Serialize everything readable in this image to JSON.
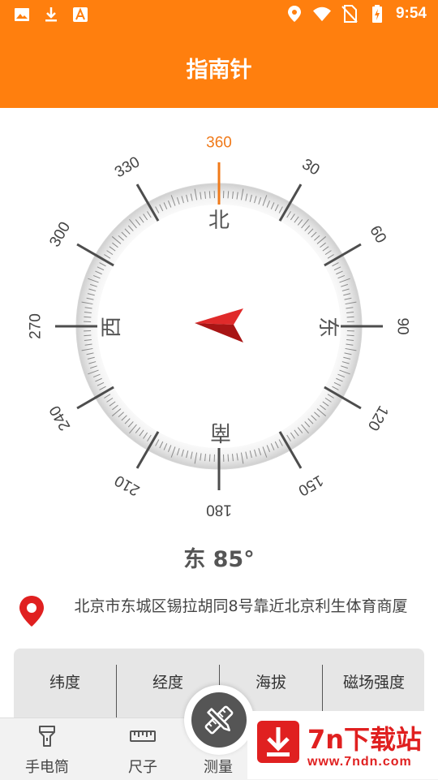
{
  "status_bar": {
    "left_icons": [
      "image-icon",
      "download-icon",
      "font-icon"
    ],
    "right_icons": [
      "location-icon",
      "wifi-icon",
      "no-sim-icon",
      "battery-charging-icon"
    ],
    "time": "9:54"
  },
  "header": {
    "title": "指南针"
  },
  "compass": {
    "degree_labels": [
      "360",
      "30",
      "60",
      "90",
      "120",
      "150",
      "180",
      "210",
      "240",
      "270",
      "300",
      "330"
    ],
    "cardinals": {
      "north": "北",
      "east": "东",
      "south": "南",
      "west": "西"
    },
    "heading_degrees": 85,
    "accent_color": "#f07a1a",
    "needle_color": "#c41f1f"
  },
  "heading": {
    "text": "东 85°"
  },
  "location": {
    "address": "北京市东城区锡拉胡同8号靠近北京利生体育商厦"
  },
  "stats": {
    "columns": [
      "纬度",
      "经度",
      "海拔",
      "磁场强度"
    ]
  },
  "bottom_nav": {
    "items": [
      {
        "label": "手电筒",
        "icon": "flashlight-icon"
      },
      {
        "label": "尺子",
        "icon": "ruler-icon"
      },
      {
        "label": "测量",
        "icon": "measure-icon"
      }
    ]
  },
  "watermark": {
    "title": "7n下载站",
    "url": "www.7ndn.com"
  },
  "colors": {
    "header_bg": "#ff7f0e",
    "watermark_red": "#e02020"
  }
}
